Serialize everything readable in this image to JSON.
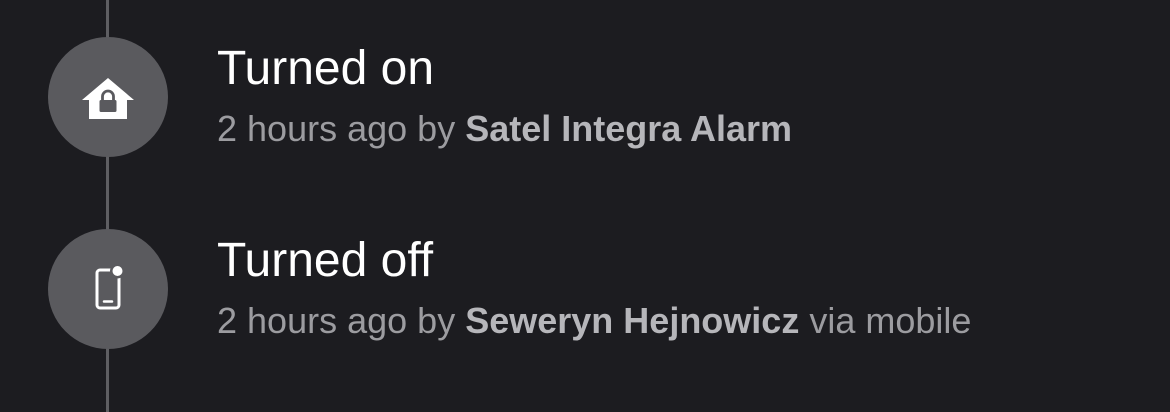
{
  "logbook": {
    "entries": [
      {
        "title": "Turned on",
        "time": "2 hours ago",
        "by": "by",
        "actor": "Satel Integra Alarm",
        "suffix": "",
        "icon": "home-lock-icon"
      },
      {
        "title": "Turned off",
        "time": "2 hours ago",
        "by": "by",
        "actor": "Seweryn Hejnowicz",
        "suffix": "via mobile",
        "icon": "cellphone-icon"
      }
    ]
  },
  "colors": {
    "background": "#1c1c20",
    "icon_circle": "#5a5a5e",
    "timeline": "#5e5e62",
    "title_text": "#ffffff",
    "meta_text": "#9c9ca0"
  }
}
